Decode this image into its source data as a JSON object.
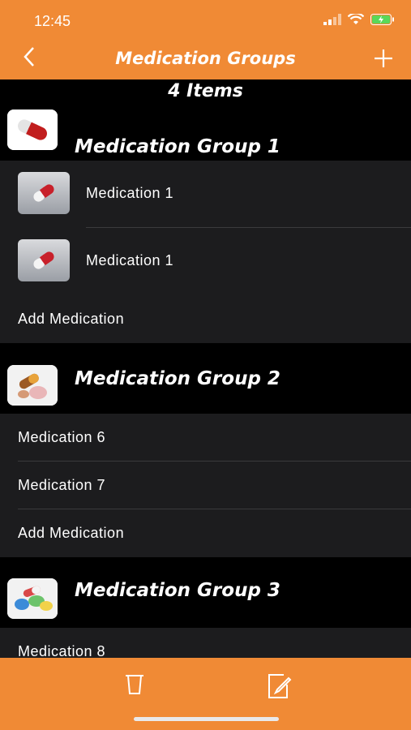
{
  "status_bar": {
    "time": "12:45"
  },
  "nav": {
    "title": "Medication Groups",
    "back_icon": "chevron-left-icon",
    "add_icon": "plus-icon"
  },
  "summary": {
    "count_label": "4 Items"
  },
  "groups": [
    {
      "title": "Medication Group 1",
      "medications": [
        {
          "label": "Medication 1"
        },
        {
          "label": "Medication 1"
        }
      ],
      "add_label": "Add Medication"
    },
    {
      "title": "Medication Group 2",
      "medications": [
        {
          "label": "Medication 6"
        },
        {
          "label": "Medication 7"
        }
      ],
      "add_label": "Add Medication"
    },
    {
      "title": "Medication Group 3",
      "medications": [
        {
          "label": "Medication 8"
        }
      ]
    }
  ],
  "toolbar": {
    "delete_icon": "trash-icon",
    "edit_icon": "edit-icon"
  },
  "colors": {
    "accent": "#f08a35",
    "row_bg": "#1c1c1e",
    "header_bg": "#000000",
    "separator": "#3a3a3c"
  }
}
